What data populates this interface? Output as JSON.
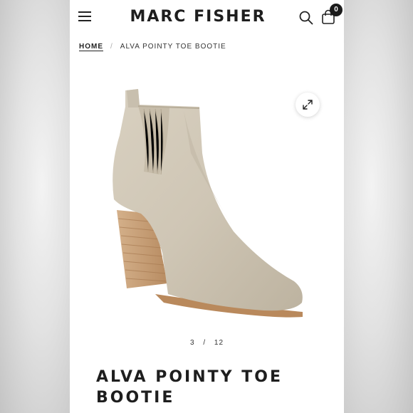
{
  "header": {
    "brand": "MARC FISHER",
    "menu_icon": "hamburger-menu-icon",
    "search_icon": "search-icon",
    "cart_icon": "shopping-bag-icon",
    "cart_count": "0"
  },
  "breadcrumb": {
    "home": "HOME",
    "separator": "/",
    "current": "ALVA POINTY TOE BOOTIE"
  },
  "gallery": {
    "expand_icon": "expand-icon",
    "current": "3",
    "separator": "/",
    "total": "12"
  },
  "product": {
    "title": "ALVA POINTY TOE BOOTIE"
  },
  "colors": {
    "text": "#1e1e1e",
    "badge": "#1c1c1c",
    "suede": "#cdc4b3",
    "heel_wood": "#c9a27a"
  }
}
